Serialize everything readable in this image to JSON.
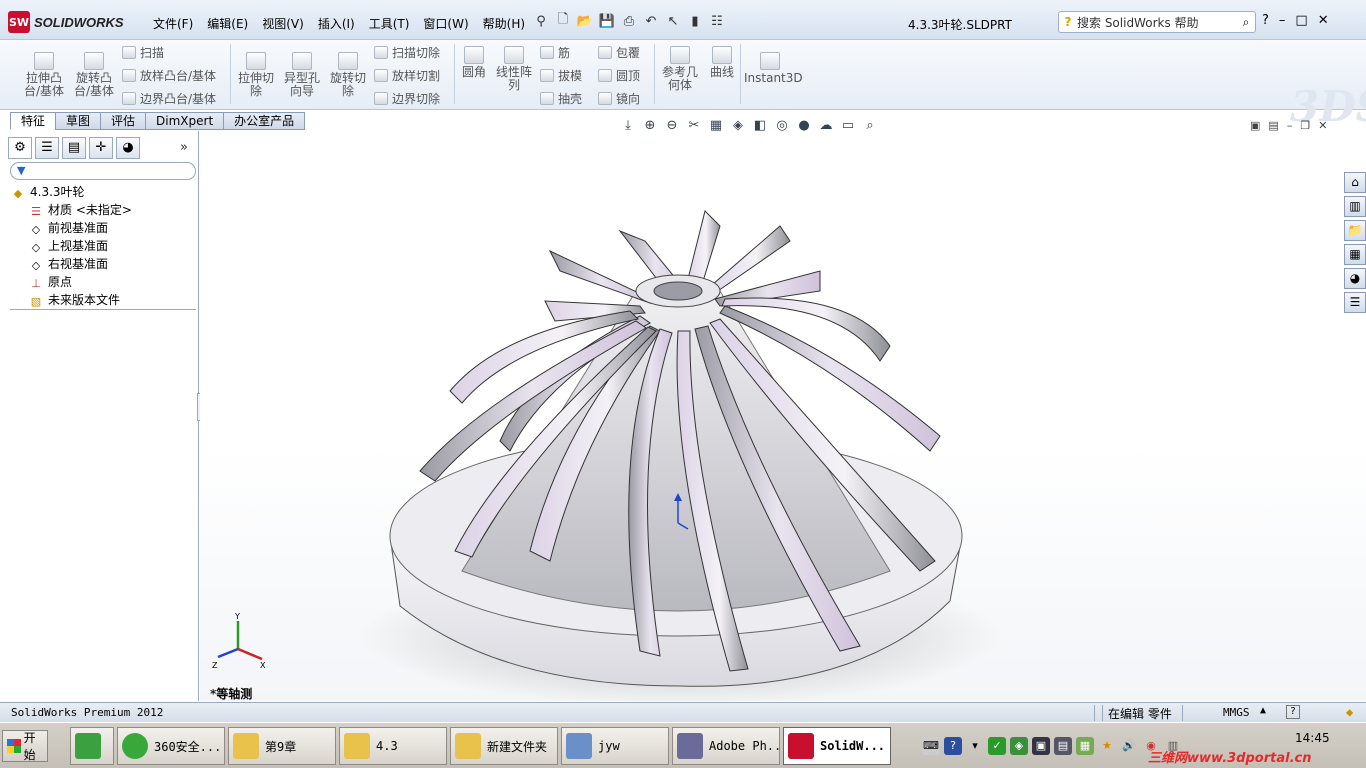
{
  "app": {
    "brand": "SOLIDWORKS",
    "logo_text": "SW"
  },
  "menu": [
    "文件(F)",
    "编辑(E)",
    "视图(V)",
    "插入(I)",
    "工具(T)",
    "窗口(W)",
    "帮助(H)"
  ],
  "quick_access": [
    "pin-icon",
    "new-document-icon",
    "open-icon",
    "save-icon",
    "print-icon",
    "undo-icon",
    "select-icon",
    "rebuild-icon",
    "options-icon"
  ],
  "document_title": "4.3.3叶轮.SLDPRT",
  "help_search": {
    "placeholder": "搜索 SolidWorks 帮助"
  },
  "window_buttons": [
    "?",
    "–",
    "□",
    "✕"
  ],
  "ribbon": {
    "extrude_boss": "拉伸凸\n台/基体",
    "revolve_boss": "旋转凸\n台/基体",
    "sweep": "扫描",
    "loft": "放样凸台/基体",
    "boundary_boss": "边界凸台/基体",
    "extrude_cut": "拉伸切\n除",
    "hole_wizard": "异型孔\n向导",
    "revolve_cut": "旋转切\n除",
    "swept_cut": "扫描切除",
    "lofted_cut": "放样切割",
    "boundary_cut": "边界切除",
    "fillet": "圆角",
    "linear_pattern": "线性阵\n列",
    "rib": "筋",
    "draft": "拔模",
    "shell": "抽壳",
    "wrap": "包覆",
    "dome": "圆顶",
    "mirror": "镜向",
    "reference_geometry": "参考几\n何体",
    "curves": "曲线",
    "instant3d": "Instant3D"
  },
  "tabs": [
    "特征",
    "草图",
    "评估",
    "DimXpert",
    "办公室产品"
  ],
  "feature_tree": {
    "root": "4.3.3叶轮",
    "items": [
      {
        "label": "材质 <未指定>",
        "icon": "material-icon"
      },
      {
        "label": "前视基准面",
        "icon": "plane-icon"
      },
      {
        "label": "上视基准面",
        "icon": "plane-icon"
      },
      {
        "label": "右视基准面",
        "icon": "plane-icon"
      },
      {
        "label": "原点",
        "icon": "origin-icon"
      },
      {
        "label": "未来版本文件",
        "icon": "future-version-icon"
      }
    ]
  },
  "graphics": {
    "view_label": "*等轴测",
    "triad": {
      "x": "X",
      "y": "Y",
      "z": "Z"
    }
  },
  "status_bar": {
    "app_name": "SolidWorks Premium 2012",
    "mode": "在编辑 零件",
    "units": "MMGS",
    "help": "?"
  },
  "taskbar": {
    "start": "开始",
    "items": [
      {
        "label": "",
        "color": "#3aa040"
      },
      {
        "label": "360安全...",
        "color": "#39a83b"
      },
      {
        "label": "第9章",
        "color": "#e8c24a"
      },
      {
        "label": "4.3",
        "color": "#e8c24a"
      },
      {
        "label": "新建文件夹",
        "color": "#e8c24a"
      },
      {
        "label": "jyw",
        "color": "#6a8fc9"
      },
      {
        "label": "Adobe Ph...",
        "color": "#6b6b9a"
      },
      {
        "label": "SolidW...",
        "color": "#c8102e"
      }
    ],
    "clock": "14:45",
    "watermark": "三维网www.3dportal.cn"
  },
  "colors": {
    "accent": "#c8102e",
    "panel_border": "#9aa9bd",
    "taskbar": "#d4d0c8"
  }
}
